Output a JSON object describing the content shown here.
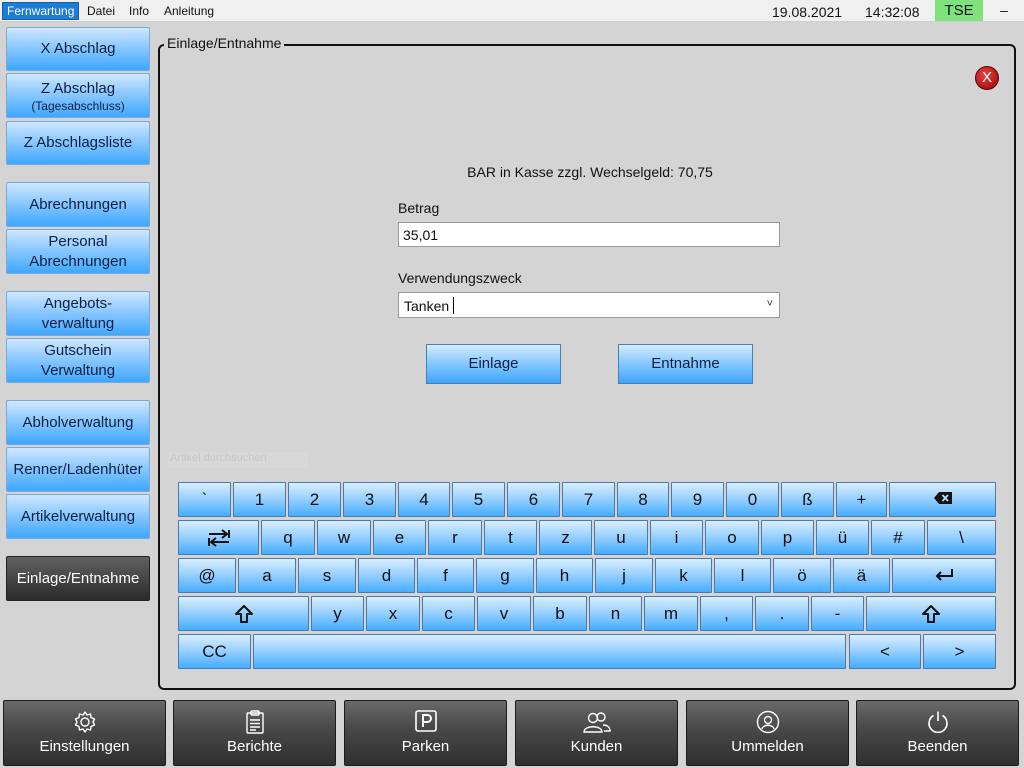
{
  "menubar": {
    "items": [
      "Fernwartung",
      "Datei",
      "Info",
      "Anleitung"
    ],
    "date": "19.08.2021",
    "time": "14:32:08",
    "tse": "TSE",
    "minimize": "–"
  },
  "sidebar": {
    "x_report": "X Abschlag",
    "z_report": "Z Abschlag",
    "z_report_sub": "(Tagesabschluss)",
    "z_list": "Z Abschlagsliste",
    "billing": "Abrechnungen",
    "staff_billing_1": "Personal",
    "staff_billing_2": "Abrechnungen",
    "offers_1": "Angebots-",
    "offers_2": "verwaltung",
    "voucher_1": "Gutschein",
    "voucher_2": "Verwaltung",
    "pickup": "Abholverwaltung",
    "bestsellers": "Renner/Ladenhüter",
    "articles": "Artikelverwaltung",
    "cash_in_out": "Einlage/Entnahme"
  },
  "panel": {
    "title": "Einlage/Entnahme",
    "close": "X",
    "cash_info": "BAR in Kasse zzgl. Wechselgeld: 70,75",
    "amount_label": "Betrag",
    "amount_value": "35,01",
    "purpose_label": "Verwendungszweck",
    "purpose_value": "Tanken",
    "deposit_button": "Einlage",
    "withdraw_button": "Entnahme",
    "ghost_text": "Artikel durchsuchen"
  },
  "keyboard": {
    "row1": [
      "`",
      "1",
      "2",
      "3",
      "4",
      "5",
      "6",
      "7",
      "8",
      "9",
      "0",
      "ß",
      "+"
    ],
    "row2": [
      "q",
      "w",
      "e",
      "r",
      "t",
      "z",
      "u",
      "i",
      "o",
      "p",
      "ü",
      "#",
      "\\"
    ],
    "row3": [
      "@",
      "a",
      "s",
      "d",
      "f",
      "g",
      "h",
      "j",
      "k",
      "l",
      "ö",
      "ä"
    ],
    "row4": [
      "y",
      "x",
      "c",
      "v",
      "b",
      "n",
      "m",
      ",",
      ".",
      "-"
    ],
    "cc": "CC",
    "left": "<",
    "right": ">",
    "icons": [
      "backspace-icon",
      "tab-icon",
      "enter-icon",
      "shift-icon"
    ]
  },
  "bottombar": {
    "settings": "Einstellungen",
    "reports": "Berichte",
    "park": "Parken",
    "customers": "Kunden",
    "switch_user": "Ummelden",
    "quit": "Beenden"
  }
}
